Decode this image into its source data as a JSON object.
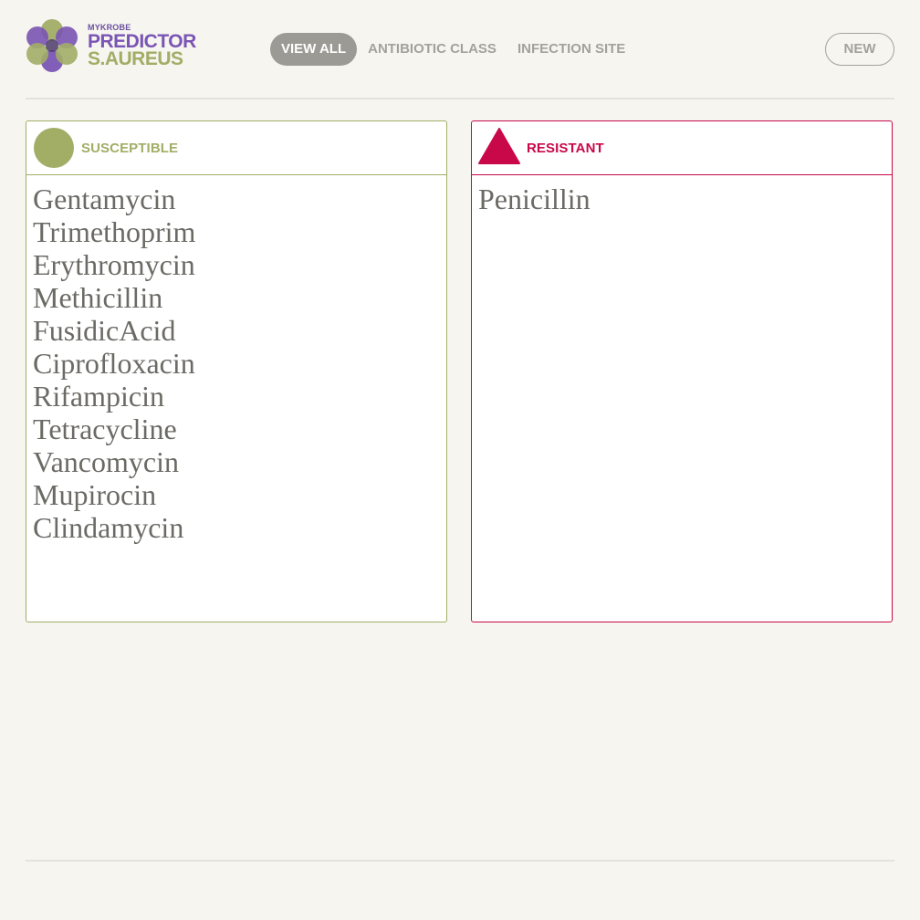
{
  "logo": {
    "brand": "MYKROBE",
    "product": "PREDICTOR",
    "species": "S.AUREUS"
  },
  "nav": {
    "items": [
      {
        "label": "VIEW ALL",
        "active": true
      },
      {
        "label": "ANTIBIOTIC CLASS",
        "active": false
      },
      {
        "label": "INFECTION SITE",
        "active": false
      }
    ],
    "new_label": "NEW"
  },
  "panels": {
    "susceptible": {
      "title": "SUSCEPTIBLE",
      "color": "#a2ad66",
      "drugs": [
        "Gentamycin",
        "Trimethoprim",
        "Erythromycin",
        "Methicillin",
        "FusidicAcid",
        "Ciprofloxacin",
        "Rifampicin",
        "Tetracycline",
        "Vancomycin",
        "Mupirocin",
        "Clindamycin"
      ]
    },
    "resistant": {
      "title": "RESISTANT",
      "color": "#c9084a",
      "drugs": [
        "Penicillin"
      ]
    }
  },
  "colors": {
    "background": "#f6f5f0",
    "brand_purple": "#7a55b3",
    "brand_green": "#a2ad66",
    "nav_active_bg": "#9b9a94",
    "nav_text": "#a3a29a"
  }
}
